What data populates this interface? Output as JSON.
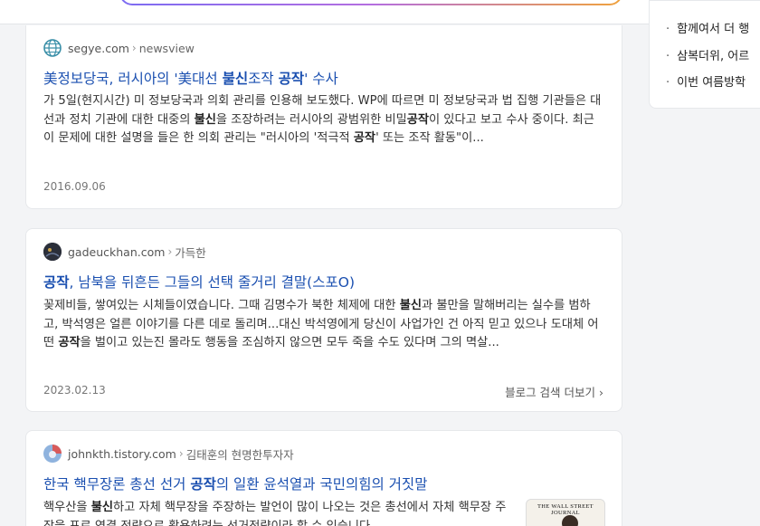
{
  "sidebar": {
    "items": [
      "함께여서 더 행",
      "삼복더위, 어르",
      "이번 여름방학"
    ]
  },
  "results": [
    {
      "domain": "segye.com",
      "path": "newsview",
      "title_parts": [
        {
          "t": "美정보당국, 러시아의 '美대선 ",
          "b": false
        },
        {
          "t": "불신",
          "b": true
        },
        {
          "t": "조작 ",
          "b": false
        },
        {
          "t": "공작",
          "b": true
        },
        {
          "t": "' 수사",
          "b": false
        }
      ],
      "desc_parts": [
        {
          "t": "가 5일(현지시간) 미 정보당국과 의회 관리를 인용해 보도했다. WP에 따르면 미 정보당국과 법 집행 기관들은 대선과 정치 기관에 대한 대중의 ",
          "b": false
        },
        {
          "t": "불신",
          "b": true
        },
        {
          "t": "을 조장하려는 러시아의 광범위한 비밀",
          "b": false
        },
        {
          "t": "공작",
          "b": true
        },
        {
          "t": "이 있다고 보고 수사 중이다. 최근 이 문제에 대한 설명을 들은 한 의회 관리는 \"러시아의 '적극적 ",
          "b": false
        },
        {
          "t": "공작",
          "b": true
        },
        {
          "t": "' 또는 조작 활동\"이...",
          "b": false
        }
      ],
      "date": "2016.09.06"
    },
    {
      "domain": "gadeuckhan.com",
      "path": "가득한",
      "title_parts": [
        {
          "t": "공작",
          "b": true
        },
        {
          "t": ", 남북을 뒤흔든 그들의 선택 줄거리 결말(스포O)",
          "b": false
        }
      ],
      "desc_parts": [
        {
          "t": "꽂제비들, 쌓여있는 시체들이였습니다. 그때 김명수가 북한 체제에 대한 ",
          "b": false
        },
        {
          "t": "불신",
          "b": true
        },
        {
          "t": "과 불만을 말해버리는 실수를 범하고, 박석영은 얼른 이야기를 다른 데로 돌리며...대신 박석영에게 당신이 사업가인 건 아직 믿고 있으나 도대체 어떤 ",
          "b": false
        },
        {
          "t": "공작",
          "b": true
        },
        {
          "t": "을 벌이고 있는진 몰라도 행동을 조심하지 않으면 모두 죽을 수도 있다며 그의 멱살...",
          "b": false
        }
      ],
      "date": "2023.02.13",
      "more_label": "블로그 검색 더보기"
    },
    {
      "domain": "johnkth.tistory.com",
      "path": "김태훈의 현명한투자자",
      "title_parts": [
        {
          "t": "한국 핵무장론 총선 선거 ",
          "b": false
        },
        {
          "t": "공작",
          "b": true
        },
        {
          "t": "의 일환 윤석열과 국민의힘의 거짓말",
          "b": false
        }
      ],
      "desc_parts": [
        {
          "t": "핵우산을 ",
          "b": false
        },
        {
          "t": "불신",
          "b": true
        },
        {
          "t": "하고 자체 핵무장을 주장하는 발언이 많이 나오는 것은 총선에서 자체 핵무장 주장을 표로 연결 전략으로 활용하려는 선거전략이라 할 수 있습니다",
          "b": false
        }
      ],
      "thumb_text": "THE WALL STREET JOURNAL"
    }
  ],
  "icons": {
    "chevron": "chevron-right-icon",
    "favicon1": "globe-icon",
    "favicon2": "dark-circle-avatar",
    "favicon3": "blue-red-avatar"
  },
  "colors": {
    "link": "#1a4fb0",
    "accent_gradient": [
      "#7c6cf2",
      "#b46ee0",
      "#f0a23c"
    ]
  }
}
